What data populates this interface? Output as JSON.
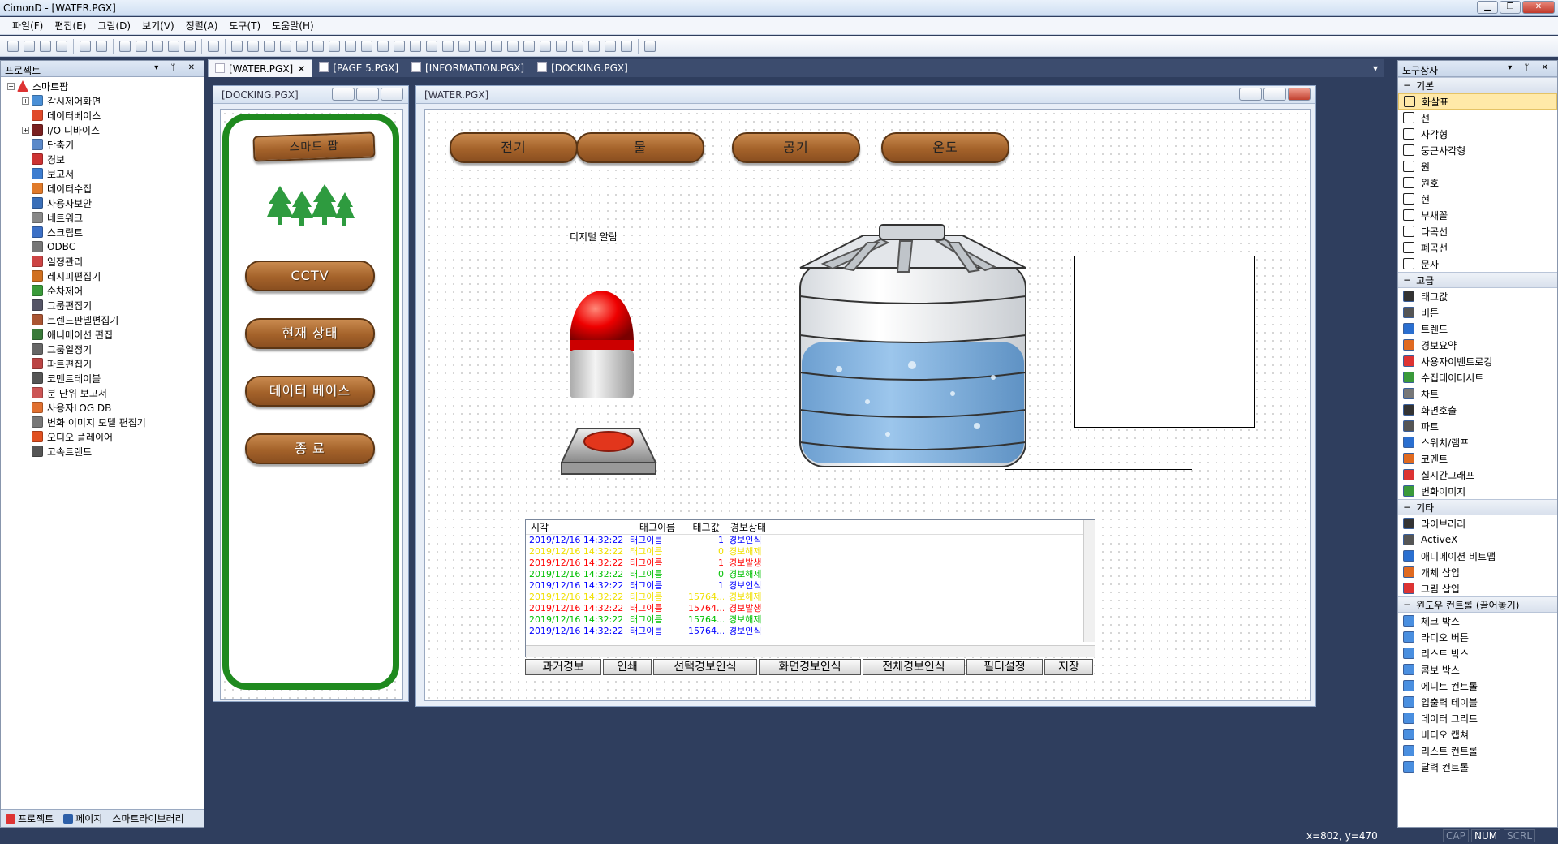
{
  "window": {
    "title": "CimonD - [WATER.PGX]"
  },
  "menu": [
    "파일(F)",
    "편집(E)",
    "그림(D)",
    "보기(V)",
    "정렬(A)",
    "도구(T)",
    "도움말(H)"
  ],
  "project_panel": {
    "title": "프로젝트",
    "root": "스마트팜",
    "items": [
      {
        "label": "감시제어화면",
        "expand": true,
        "color": "#4a8fd6"
      },
      {
        "label": "데이터베이스",
        "color": "#e04a2a"
      },
      {
        "label": "I/O 디바이스",
        "expand": true,
        "color": "#7a2020"
      },
      {
        "label": "단축키",
        "color": "#5b89c9"
      },
      {
        "label": "경보",
        "color": "#c33"
      },
      {
        "label": "보고서",
        "color": "#3d7dd0"
      },
      {
        "label": "데이터수집",
        "color": "#e07a2a"
      },
      {
        "label": "사용자보안",
        "color": "#3a6fb8"
      },
      {
        "label": "네트워크",
        "color": "#888"
      },
      {
        "label": "스크립트",
        "color": "#3c70c6"
      },
      {
        "label": "ODBC",
        "color": "#777"
      },
      {
        "label": "일정관리",
        "color": "#c44"
      },
      {
        "label": "레시피편집기",
        "color": "#d07020"
      },
      {
        "label": "순차제어",
        "color": "#3a9a3a"
      },
      {
        "label": "그룹편집기",
        "color": "#556"
      },
      {
        "label": "트렌드판넬편집기",
        "color": "#a53"
      },
      {
        "label": "애니메이션 편집",
        "color": "#3a7a3a"
      },
      {
        "label": "그룹일정기",
        "color": "#666"
      },
      {
        "label": "파트편집기",
        "color": "#b44"
      },
      {
        "label": "코멘트테이블",
        "color": "#555"
      },
      {
        "label": "분 단위 보고서",
        "color": "#c55"
      },
      {
        "label": "사용자LOG DB",
        "color": "#e07030"
      },
      {
        "label": "변화 이미지 모델 편집기",
        "color": "#777"
      },
      {
        "label": "오디오 플레이어",
        "color": "#e05020"
      },
      {
        "label": "고속트렌드",
        "color": "#555"
      }
    ],
    "bottom_tabs": [
      "프로젝트",
      "페이지",
      "스마트라이브러리"
    ]
  },
  "doc_tabs": [
    "[WATER.PGX]",
    "[PAGE 5.PGX]",
    "[INFORMATION.PGX]",
    "[DOCKING.PGX]"
  ],
  "docking": {
    "title": "[DOCKING.PGX]",
    "sign": "스마트 팜",
    "buttons": [
      "CCTV",
      "현재 상태",
      "데이터 베이스",
      "종 료"
    ]
  },
  "water": {
    "title": "[WATER.PGX]",
    "nav_buttons": [
      "전기",
      "물",
      "공기",
      "온도"
    ],
    "alarm_label": "디지털 알람",
    "tank_level_pct": 65
  },
  "alarm_table": {
    "headers": [
      "시각",
      "태그이름",
      "태그값",
      "경보상태"
    ],
    "rows": [
      {
        "time": "2019/12/16 14:32:22",
        "tag": "태그이름",
        "val": "1",
        "state": "경보인식",
        "color": "#0000ff"
      },
      {
        "time": "2019/12/16 14:32:22",
        "tag": "태그이름",
        "val": "0",
        "state": "경보해제",
        "color": "#f0e000"
      },
      {
        "time": "2019/12/16 14:32:22",
        "tag": "태그이름",
        "val": "1",
        "state": "경보발생",
        "color": "#ff0000"
      },
      {
        "time": "2019/12/16 14:32:22",
        "tag": "태그이름",
        "val": "0",
        "state": "경보해제",
        "color": "#00c000"
      },
      {
        "time": "2019/12/16 14:32:22",
        "tag": "태그이름",
        "val": "1",
        "state": "경보인식",
        "color": "#0000ff"
      },
      {
        "time": "2019/12/16 14:32:22",
        "tag": "태그이름",
        "val": "15764...",
        "state": "경보해제",
        "color": "#f0e000"
      },
      {
        "time": "2019/12/16 14:32:22",
        "tag": "태그이름",
        "val": "15764...",
        "state": "경보발생",
        "color": "#ff0000"
      },
      {
        "time": "2019/12/16 14:32:22",
        "tag": "태그이름",
        "val": "15764...",
        "state": "경보해제",
        "color": "#00c000"
      },
      {
        "time": "2019/12/16 14:32:22",
        "tag": "태그이름",
        "val": "15764...",
        "state": "경보인식",
        "color": "#0000ff"
      }
    ],
    "buttons": [
      "과거경보",
      "인쇄",
      "선택경보인식",
      "화면경보인식",
      "전체경보인식",
      "필터설정",
      "저장"
    ]
  },
  "toolbox": {
    "title": "도구상자",
    "groups": [
      {
        "name": "기본",
        "items": [
          "화살표",
          "선",
          "사각형",
          "둥근사각형",
          "원",
          "원호",
          "현",
          "부채꼴",
          "다곡선",
          "폐곡선",
          "문자"
        ]
      },
      {
        "name": "고급",
        "items": [
          "태그값",
          "버튼",
          "트렌드",
          "경보요약",
          "사용자이벤트로깅",
          "수집데이터시트",
          "차트",
          "화면호출",
          "파트",
          "스위치/램프",
          "코멘트",
          "실시간그래프",
          "변화이미지"
        ]
      },
      {
        "name": "기타",
        "items": [
          "라이브러리",
          "ActiveX",
          "애니메이션 비트맵",
          "개체 삽입",
          "그림 삽입"
        ]
      },
      {
        "name": "윈도우 컨트롤 (끌어놓기)",
        "items": [
          "체크 박스",
          "라디오 버튼",
          "리스트 박스",
          "콤보 박스",
          "에디트 컨트롤",
          "입출력 테이블",
          "데이터 그리드",
          "비디오 캡쳐",
          "리스트 컨트롤",
          "달력 컨트롤"
        ]
      }
    ]
  },
  "status": {
    "coords": "x=802, y=470",
    "cap": "CAP",
    "num": "NUM",
    "scrl": "SCRL"
  }
}
